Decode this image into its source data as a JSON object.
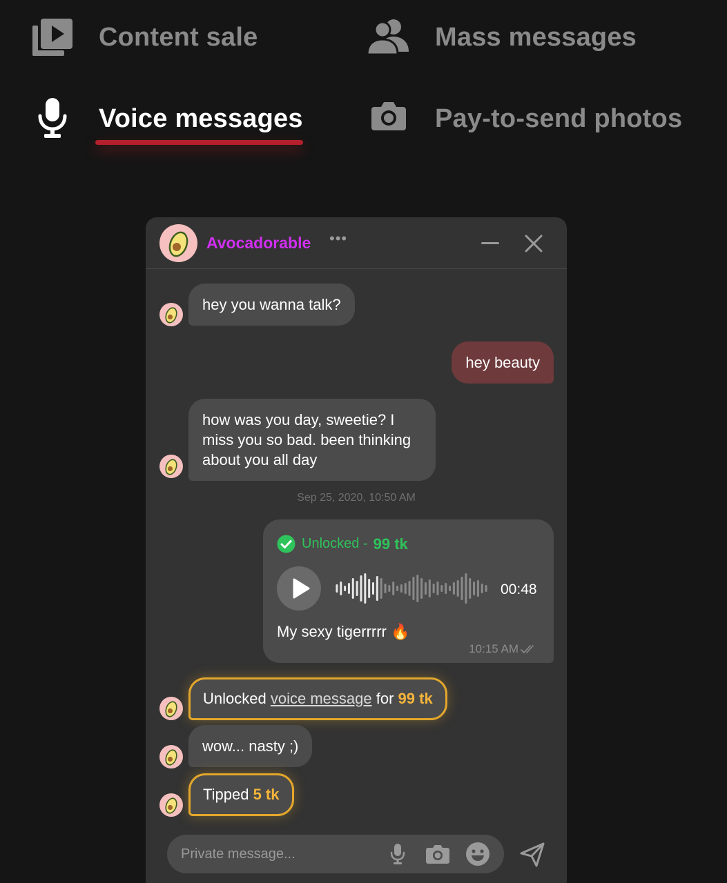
{
  "tabs": [
    {
      "label": "Content sale",
      "icon": "video-library-icon",
      "active": false
    },
    {
      "label": "Mass messages",
      "icon": "users-icon",
      "active": false
    },
    {
      "label": "Voice messages",
      "icon": "microphone-icon",
      "active": true
    },
    {
      "label": "Pay-to-send photos",
      "icon": "camera-icon",
      "active": false
    }
  ],
  "colors": {
    "accent_red": "#b3202b",
    "username": "#d12ff2",
    "unlocked_green": "#2fc35b",
    "gold": "#f5b43a",
    "outgoing_bubble": "#6e3a3c"
  },
  "chat": {
    "username": "Avocadorable",
    "more": "•••",
    "messages": {
      "m1": "hey you wanna talk?",
      "m2": "hey beauty",
      "m3": "how was you day, sweetie? I miss you so bad. been thinking about you all day"
    },
    "timestamp": "Sep 25, 2020, 10:50 AM",
    "voice": {
      "unlocked_label": "Unlocked -",
      "price": "99 tk",
      "duration": "00:48",
      "caption": "My sexy tigerrrrr 🔥",
      "time": "10:15 AM"
    },
    "unlock_notice": {
      "prefix": "Unlocked",
      "link": "voice message",
      "middle": "for",
      "price": "99 tk"
    },
    "m4": "wow... nasty ;)",
    "tip_notice": {
      "prefix": "Tipped",
      "amount": "5 tk"
    },
    "composer": {
      "placeholder": "Private message..."
    }
  }
}
